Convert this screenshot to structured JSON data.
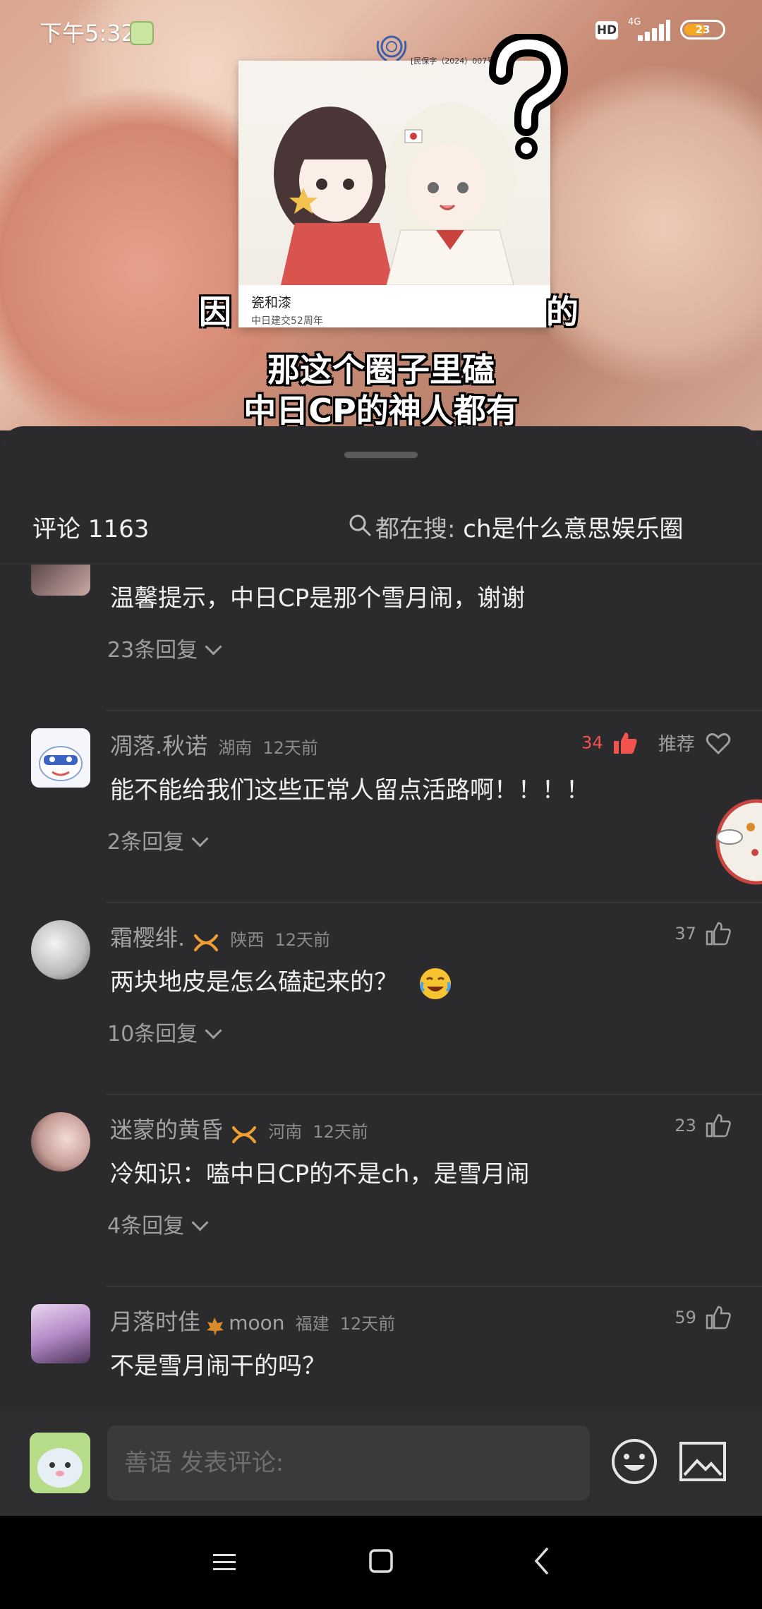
{
  "status_bar": {
    "time": "下午5:32",
    "hd": "HD",
    "network": "4G",
    "battery": "23"
  },
  "video": {
    "card_title": "瓷和漆",
    "card_subtitle": "中日建交52周年",
    "card_doc_label": "[民保字（2024）007号]",
    "caption_line1_left": "因",
    "caption_line1_right": "的",
    "caption_line2": "那这个圈子里磕",
    "caption_line3": "中日CP的神人都有"
  },
  "sheet": {
    "comment_count_label": "评论 1163",
    "search_prefix": "都在搜:",
    "search_query": "ch是什么意思娱乐圈"
  },
  "comments": [
    {
      "name": "",
      "location": "",
      "time": "",
      "text": "温馨提示，中日CP是那个雪月闹，谢谢",
      "replies": "23条回复",
      "likes": ""
    },
    {
      "name": "凋落.秋诺",
      "location": "湖南",
      "time": "12天前",
      "text": "能不能给我们这些正常人留点活路啊！！！！",
      "replies": "2条回复",
      "likes": "34",
      "recommend": "推荐"
    },
    {
      "name": "霜樱绯.",
      "location": "陕西",
      "time": "12天前",
      "text": "两块地皮是怎么磕起来的？",
      "replies": "10条回复",
      "likes": "37"
    },
    {
      "name": "迷蒙的黄昏",
      "location": "河南",
      "time": "12天前",
      "text": "冷知识：嗑中日CP的不是ch，是雪月闹",
      "replies": "4条回复",
      "likes": "23"
    },
    {
      "name": "月落时佳",
      "name_suffix": "moon",
      "location": "福建",
      "time": "12天前",
      "text": "不是雪月闹干的吗？",
      "replies": "",
      "likes": "59"
    }
  ],
  "input_bar": {
    "placeholder": "善语 发表评论:"
  },
  "colors": {
    "sheet_bg": "#2b2b2d",
    "hot_like": "#f2534c",
    "badge_orange": "#f0a030"
  }
}
